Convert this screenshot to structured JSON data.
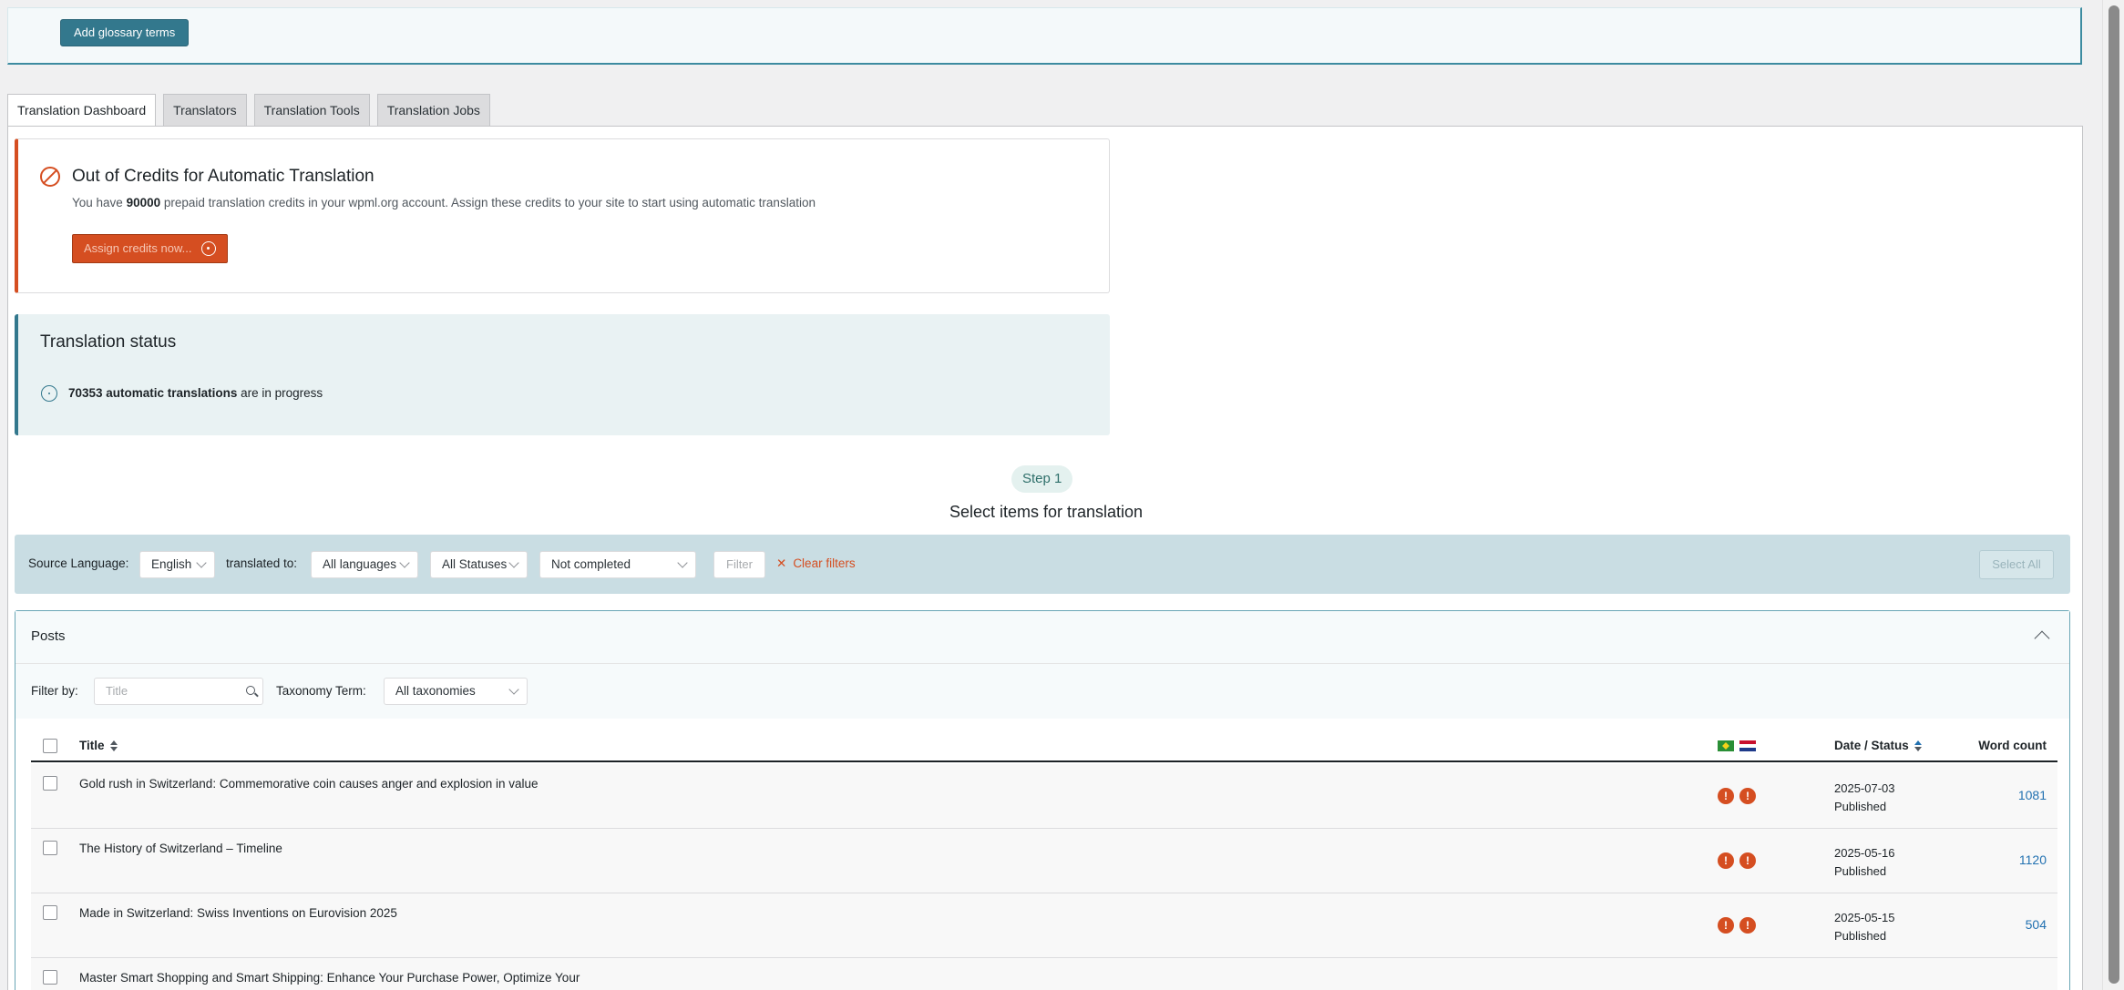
{
  "glossary": {
    "button_label": "Add glossary terms"
  },
  "tabs": [
    {
      "label": "Translation Dashboard",
      "active": true
    },
    {
      "label": "Translators",
      "active": false
    },
    {
      "label": "Translation Tools",
      "active": false
    },
    {
      "label": "Translation Jobs",
      "active": false
    }
  ],
  "credits_notice": {
    "title": "Out of Credits for Automatic Translation",
    "desc_prefix": "You have ",
    "credits": "90000",
    "desc_suffix": " prepaid translation credits in your wpml.org account. Assign these credits to your site to start using automatic translation",
    "button_label": "Assign credits now...",
    "accent_color": "#d54e21"
  },
  "translation_status": {
    "title": "Translation status",
    "count_text": "70353 automatic translations",
    "suffix": " are in progress"
  },
  "step": {
    "pill": "Step 1",
    "title": "Select items for translation"
  },
  "filter_bar": {
    "source_language_label": "Source Language:",
    "source_language_value": "English",
    "translated_to_label": "translated to:",
    "languages_value": "All languages",
    "statuses_value": "All Statuses",
    "completion_value": "Not completed",
    "filter_button": "Filter",
    "clear_filters": "Clear filters",
    "select_all": "Select All"
  },
  "posts": {
    "section_title": "Posts",
    "filter_by_label": "Filter by:",
    "title_placeholder": "Title",
    "taxonomy_label": "Taxonomy Term:",
    "taxonomy_value": "All taxonomies",
    "columns": {
      "title": "Title",
      "date_status": "Date / Status",
      "word_count": "Word count"
    },
    "language_flags": [
      "pt-br-flag-icon",
      "nl-flag-icon"
    ],
    "rows": [
      {
        "title": "Gold rush in Switzerland: Commemorative coin causes anger and explosion in value",
        "date": "2025-07-03",
        "status": "Published",
        "word_count": "1081"
      },
      {
        "title": "The History of Switzerland – Timeline",
        "date": "2025-05-16",
        "status": "Published",
        "word_count": "1120"
      },
      {
        "title": "Made in Switzerland: Swiss Inventions on Eurovision 2025",
        "date": "2025-05-15",
        "status": "Published",
        "word_count": "504"
      },
      {
        "title": "Master Smart Shopping and Smart Shipping: Enhance Your Purchase Power, Optimize Your",
        "date": "",
        "status": "",
        "word_count": ""
      }
    ]
  }
}
